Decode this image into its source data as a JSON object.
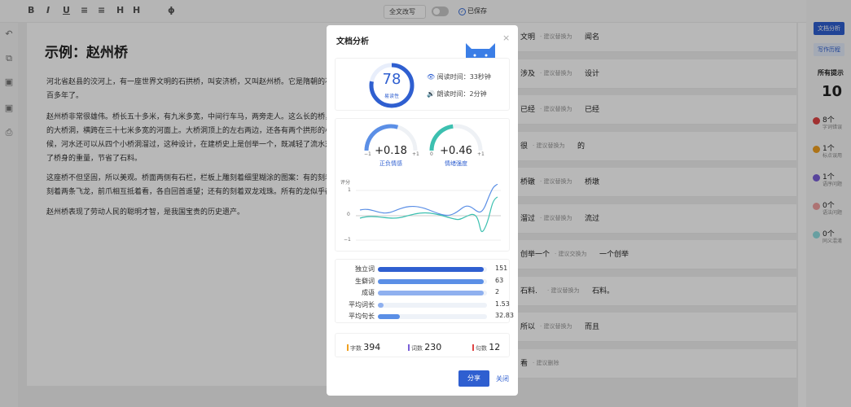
{
  "toolbar": {
    "icons": [
      "bold-icon",
      "italic-icon",
      "underline-icon",
      "bullet-list-icon",
      "numbered-list-icon",
      "heading-icon",
      "heading2-icon",
      "clear-format-icon"
    ],
    "glyphs": [
      "B",
      "I",
      "U",
      "≡",
      "≡",
      "H",
      "H",
      "ɸ"
    ],
    "mode_label": "全文改写",
    "saved_label": "已保存"
  },
  "document": {
    "title": "示例：赵州桥",
    "paragraphs": [
      "河北省赵县的洨河上，有一座世界文明的石拱桥，叫安济桥，又叫赵州桥。它是隋朝的石匠李春设计和参加建造的，到现在已经有一千三百多年了。",
      "赵州桥非常很雄伟。桥长五十多米，有九米多宽，中间行车马，两旁走人。这么长的桥，全部用石头砌成，下面没有桥礅，只有一个拱形的大桥洞，横跨在三十七米多宽的河面上。大桥洞顶上的左右两边，还各有两个拱形的小桥洞。平时，河水从大桥洞流过，发大水的时候，河水还可以从四个小桥洞溜过，这种设计，在建桥史上是创举一个，既减轻了流水对桥身的冲击力，使桥不容易被大水冲毁，又减轻了桥身的重量，节省了石料。",
      "这座桥不但坚固，所以美观。桥面两侧有石栏，栏板上雕刻着细里糊涂的图案：有的刻着两条相互缠绕的龙，嘴里吐出美丽的水花；有的刻着两条飞龙，前爪相互抵着看，各自回首遥望；还有的刻着双龙戏珠。所有的龙似乎都在游动，真像活了一样。",
      "赵州桥表现了劳动人民的聪明才智，是我国宝贵的历史遗产。"
    ]
  },
  "suggestions": [
    {
      "word": "文明",
      "hint": "· 建议替换为",
      "rep": "闻名"
    },
    {
      "word": "涉及",
      "hint": "· 建议替换为",
      "rep": "设计"
    },
    {
      "word": "已经",
      "hint": "· 建议替换为",
      "rep": "已经"
    },
    {
      "word": "很",
      "hint": "· 建议替换为",
      "rep": "的"
    },
    {
      "word": "桥礅",
      "hint": "· 建议替换为",
      "rep": "桥墩"
    },
    {
      "word": "溜过",
      "hint": "· 建议替换为",
      "rep": "流过"
    },
    {
      "word": "创举一个",
      "hint": "· 建议交换为",
      "rep": "一个创举"
    },
    {
      "word": "石料.",
      "hint": "· 建议替换为",
      "rep": "石料。"
    },
    {
      "word": "所以",
      "hint": "· 建议替换为",
      "rep": "而且"
    },
    {
      "word": "看",
      "hint": "· 建议删除",
      "rep": ""
    }
  ],
  "sidebar": {
    "analysis_btn": "文档分析",
    "history_btn": "写作历程",
    "all_tips_label": "所有提示",
    "all_tips_count": "10",
    "categories": [
      {
        "count": "8个",
        "label": "字词错误",
        "color": "#e04545"
      },
      {
        "count": "1个",
        "label": "标点误用",
        "color": "#f0a020"
      },
      {
        "count": "1个",
        "label": "语序问题",
        "color": "#7a5fd8"
      },
      {
        "count": "0个",
        "label": "语法问题",
        "color": "#f0a0a0"
      },
      {
        "count": "0个",
        "label": "同义混淆",
        "color": "#90dde0"
      }
    ]
  },
  "modal": {
    "title": "文档分析",
    "close_icon": "×",
    "score": "78",
    "score_label": "易读性",
    "score_fraction": 0.78,
    "read_time_label": "阅读时间：33秒钟",
    "speak_time_label": "朗读时间：2分钟",
    "sentiment": {
      "value": "+0.18",
      "label": "正负情感",
      "min": "−1",
      "max": "+1",
      "fraction": 0.59,
      "color": "#5b8fe6"
    },
    "intensity": {
      "value": "+0.46",
      "label": "情绪强度",
      "min": "0",
      "max": "+1",
      "fraction": 0.46,
      "color": "#3cc0b0"
    },
    "chart": {
      "ylabel": "评分",
      "ticks": [
        "1",
        "0",
        "−1"
      ]
    },
    "stats": [
      {
        "label": "独立词",
        "value": "151",
        "fraction": 0.97,
        "color": "#2f5fd0"
      },
      {
        "label": "生僻词",
        "value": "63",
        "fraction": 0.97,
        "color": "#5b8fe6"
      },
      {
        "label": "成语",
        "value": "2",
        "fraction": 0.97,
        "color": "#8fb0ef"
      },
      {
        "label": "平均词长",
        "value": "1.53",
        "fraction": 0.05,
        "color": "#8fb0ef"
      },
      {
        "label": "平均句长",
        "value": "32.83",
        "fraction": 0.2,
        "color": "#5b8fe6"
      }
    ],
    "counts": [
      {
        "label": "字数",
        "value": "394",
        "color": "#f0a020"
      },
      {
        "label": "词数",
        "value": "230",
        "color": "#7a5fd8"
      },
      {
        "label": "句数",
        "value": "12",
        "color": "#e04545"
      }
    ],
    "share_btn": "分享",
    "close_btn": "关闭"
  }
}
